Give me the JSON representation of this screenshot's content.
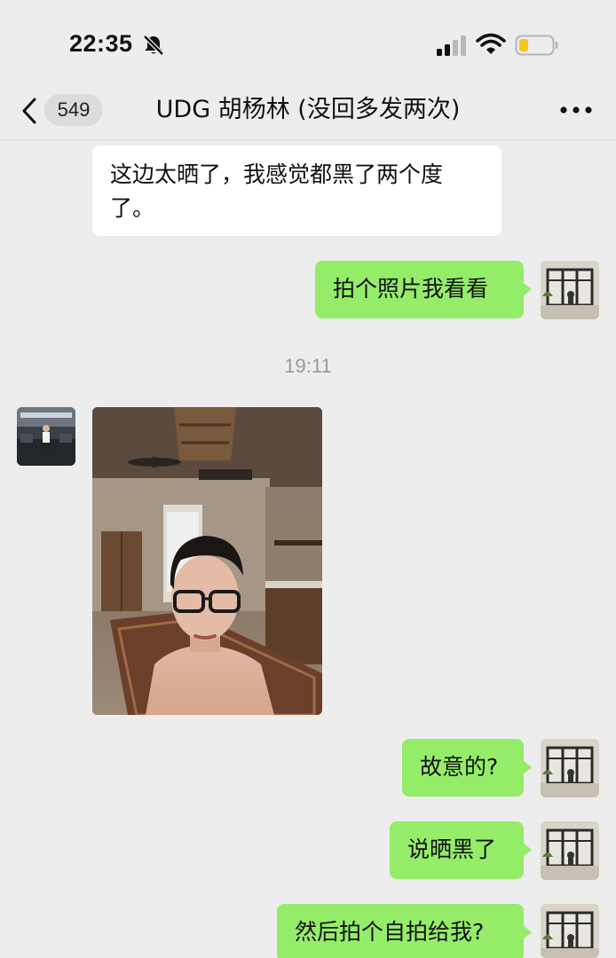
{
  "status_bar": {
    "time": "22:35",
    "mute_icon": "bell-slash-icon",
    "signal_icon": "cellular-signal-icon",
    "wifi_icon": "wifi-icon",
    "battery_icon": "battery-low-icon",
    "battery_color": "#f5c518"
  },
  "nav": {
    "back_icon": "chevron-left-icon",
    "unread_count": "549",
    "title": "UDG 胡杨林 (没回多发两次)",
    "more_icon": "more-dots-icon"
  },
  "messages": [
    {
      "direction": "in",
      "text": "这边太晒了，我感觉都黑了两个度了。"
    },
    {
      "direction": "out",
      "text": "拍个照片我看看"
    },
    {
      "type": "time",
      "text": "19:11"
    },
    {
      "direction": "in",
      "type": "image",
      "content": "selfie-photo"
    },
    {
      "direction": "out",
      "text": "故意的?"
    },
    {
      "direction": "out",
      "text": "说晒黑了"
    },
    {
      "direction": "out",
      "text": "然后拍个自拍给我?"
    }
  ],
  "colors": {
    "background": "#ededed",
    "outgoing_bubble": "#95ec69",
    "incoming_bubble": "#ffffff"
  }
}
